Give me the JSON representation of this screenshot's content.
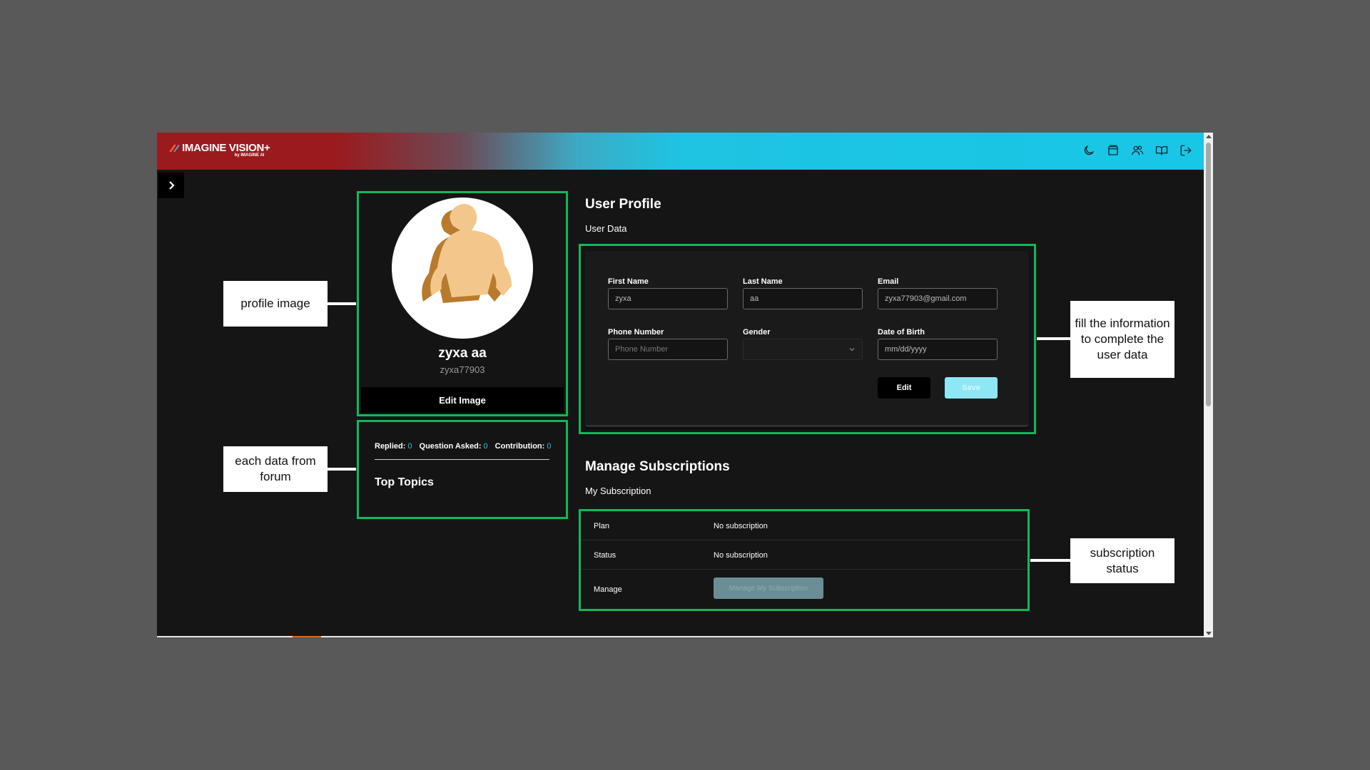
{
  "app": {
    "logo_text": "IMAGINE VISION+",
    "logo_sub": "by IMAGINE AI"
  },
  "header_icons": [
    "moon-icon",
    "layout-icon",
    "users-icon",
    "book-icon",
    "logout-icon"
  ],
  "profile": {
    "name": "zyxa aa",
    "username": "zyxa77903",
    "edit_image_label": "Edit Image"
  },
  "forum": {
    "replied_label": "Replied:",
    "replied_value": "0",
    "question_label": "Question Asked:",
    "question_value": "0",
    "contribution_label": "Contribution:",
    "contribution_value": "0",
    "top_topics": "Top Topics"
  },
  "user_profile": {
    "title": "User Profile",
    "section": "User Data",
    "fields": {
      "first_name_label": "First Name",
      "first_name_value": "zyxa",
      "last_name_label": "Last Name",
      "last_name_value": "aa",
      "email_label": "Email",
      "email_value": "zyxa77903@gmail.com",
      "phone_label": "Phone Number",
      "phone_placeholder": "Phone Number",
      "gender_label": "Gender",
      "gender_value": "",
      "dob_label": "Date of Birth",
      "dob_value": "mm/dd/yyyy"
    },
    "edit_label": "Edit",
    "save_label": "Save"
  },
  "subscriptions": {
    "title": "Manage Subscriptions",
    "section": "My Subscription",
    "plan_label": "Plan",
    "plan_value": "No subscription",
    "status_label": "Status",
    "status_value": "No subscription",
    "manage_label": "Manage",
    "manage_button": "Manage My Subscription"
  },
  "annotations": {
    "profile_image": "profile image",
    "forum_data": "each data from forum",
    "user_data": "fill the information to complete the user data",
    "subscription": "subscription status"
  },
  "colors": {
    "highlight": "#10b85a",
    "brand_red": "#9b1a1e",
    "brand_cyan": "#18c6e6",
    "stat_number": "#1ec4e2"
  }
}
